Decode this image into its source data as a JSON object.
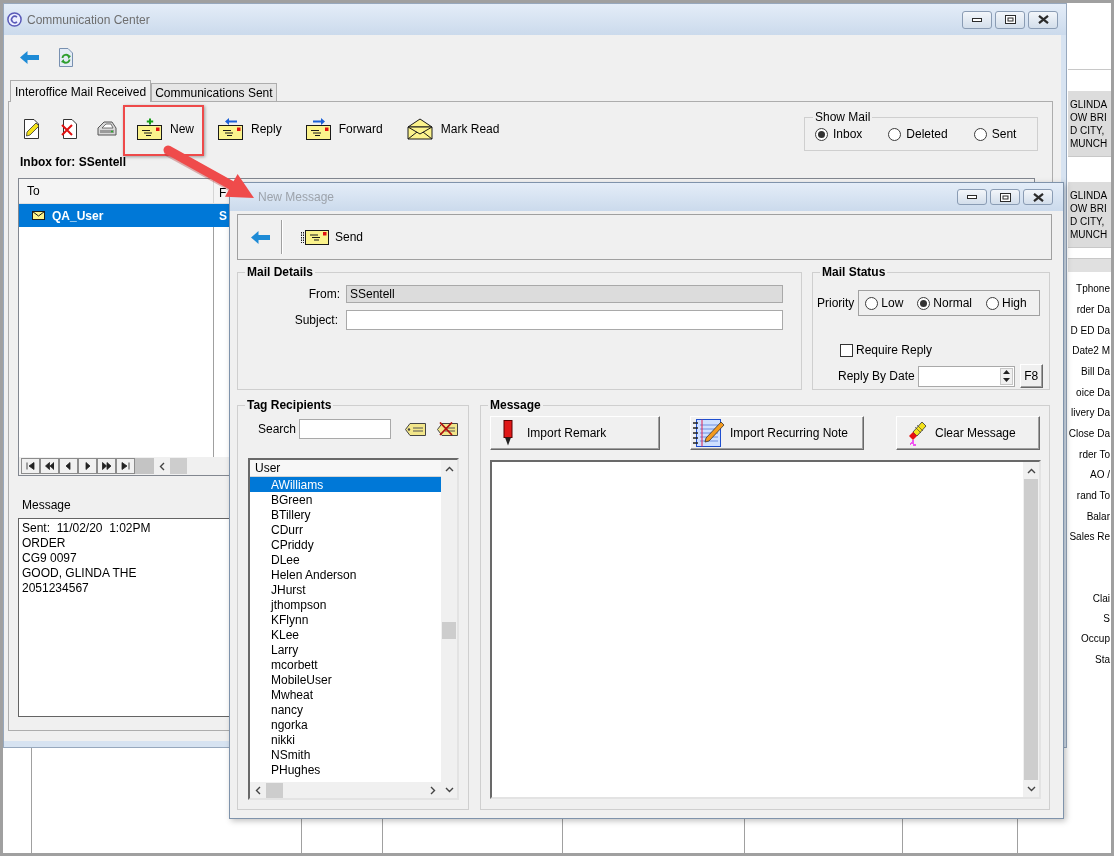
{
  "window": {
    "title": "Communication Center"
  },
  "tabs": [
    {
      "label": "Interoffice Mail Received",
      "selected": true
    },
    {
      "label": "Communications Sent",
      "selected": false
    }
  ],
  "mail_toolbar": [
    {
      "kind": "new",
      "label": "New",
      "highlighted": true
    },
    {
      "kind": "reply",
      "label": "Reply",
      "highlighted": false
    },
    {
      "kind": "forward",
      "label": "Forward",
      "highlighted": false
    },
    {
      "kind": "read",
      "label": "Mark Read",
      "highlighted": false
    }
  ],
  "show_mail": {
    "title": "Show Mail",
    "options": [
      {
        "label": "Inbox",
        "selected": true
      },
      {
        "label": "Deleted",
        "selected": false
      },
      {
        "label": "Sent",
        "selected": false
      }
    ]
  },
  "inbox_label": "Inbox for: SSentell",
  "mail_table": {
    "columns": [
      "To",
      "F"
    ],
    "rows": [
      {
        "cells": [
          "QA_User",
          "S"
        ],
        "selected": true
      }
    ]
  },
  "message_preview": {
    "label": "Message",
    "lines": [
      "Sent:  11/02/20  1:02PM",
      "ORDER",
      "CG9 0097",
      "GOOD, GLINDA THE",
      "2051234567"
    ]
  },
  "new_message": {
    "title": "New Message",
    "send": "Send",
    "mail_details": {
      "title": "Mail Details",
      "from_label": "From:",
      "from_value": "SSentell",
      "subject_label": "Subject:"
    },
    "mail_status": {
      "title": "Mail Status",
      "priority_label": "Priority",
      "priorities": [
        {
          "label": "Low",
          "selected": false
        },
        {
          "label": "Normal",
          "selected": true
        },
        {
          "label": "High",
          "selected": false
        }
      ],
      "require_reply": {
        "label": "Require Reply",
        "checked": false
      },
      "reply_by_label": "Reply By Date",
      "date_button": "F8"
    },
    "tag_recipients": {
      "title": "Tag Recipients",
      "search_label": "Search",
      "list_header": "User",
      "users": [
        {
          "name": "AWilliams",
          "selected": true
        },
        {
          "name": "BGreen",
          "selected": false
        },
        {
          "name": "BTillery",
          "selected": false
        },
        {
          "name": "CDurr",
          "selected": false
        },
        {
          "name": "CPriddy",
          "selected": false
        },
        {
          "name": "DLee",
          "selected": false
        },
        {
          "name": "Helen Anderson",
          "selected": false
        },
        {
          "name": "JHurst",
          "selected": false
        },
        {
          "name": "jthompson",
          "selected": false
        },
        {
          "name": "KFlynn",
          "selected": false
        },
        {
          "name": "KLee",
          "selected": false
        },
        {
          "name": "Larry",
          "selected": false
        },
        {
          "name": "mcorbett",
          "selected": false
        },
        {
          "name": "MobileUser",
          "selected": false
        },
        {
          "name": "Mwheat",
          "selected": false
        },
        {
          "name": "nancy",
          "selected": false
        },
        {
          "name": "ngorka",
          "selected": false
        },
        {
          "name": "nikki",
          "selected": false
        },
        {
          "name": "NSmith",
          "selected": false
        },
        {
          "name": "PHughes",
          "selected": false
        }
      ]
    },
    "message": {
      "title": "Message",
      "buttons": [
        {
          "kind": "remark",
          "label": "Import Remark"
        },
        {
          "kind": "note",
          "label": "Import Recurring Note"
        },
        {
          "kind": "clear",
          "label": "Clear Message"
        }
      ]
    }
  },
  "background_panel": {
    "address_blocks": [
      [
        "GLINDA",
        "OW BRI",
        "D CITY,",
        "MUNCH"
      ],
      [
        "GLINDA",
        "OW BRI",
        "D CITY,",
        "MUNCH"
      ]
    ],
    "label_groups": [
      [
        "Tphone",
        "rder Da",
        "D ED Da",
        "Date2 M",
        "Bill Da",
        "oice Da",
        "livery Da",
        "Close Da",
        "rder To",
        "AO /",
        "rand To",
        "Balar",
        "Sales Re"
      ],
      [
        "Clai",
        "S",
        "Occup",
        "Sta"
      ]
    ]
  }
}
